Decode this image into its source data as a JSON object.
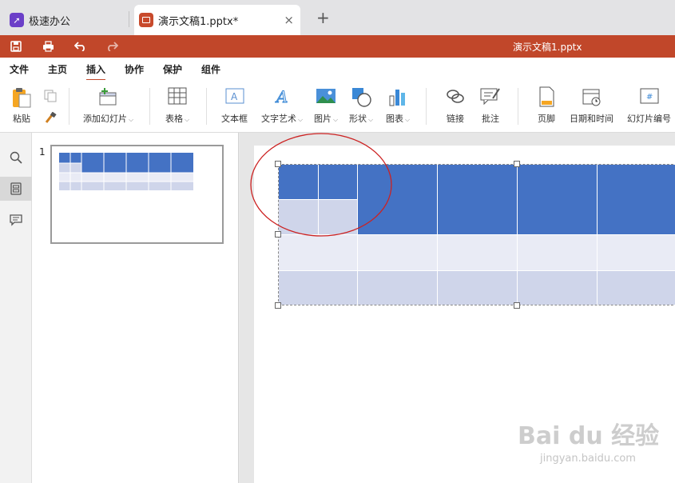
{
  "tabs": {
    "home_label": "极速办公",
    "doc_label": "演示文稿1.pptx*",
    "close_glyph": "×",
    "add_glyph": "+"
  },
  "titlebar": {
    "title": "演示文稿1.pptx"
  },
  "menu": {
    "items": [
      "文件",
      "主页",
      "插入",
      "协作",
      "保护",
      "组件"
    ],
    "active": "插入"
  },
  "ribbon": {
    "paste": "粘贴",
    "add_slide": "添加幻灯片",
    "table": "表格",
    "textbox": "文本框",
    "wordart": "文字艺术",
    "picture": "图片",
    "shape": "形状",
    "chart": "图表",
    "link": "链接",
    "comment": "批注",
    "footer": "页脚",
    "datetime": "日期和时间",
    "slide_number": "幻灯片编号"
  },
  "thumbnails": {
    "number": "1"
  },
  "watermark": {
    "brand": "Bai du 经验",
    "url": "jingyan.baidu.com"
  },
  "colors": {
    "accent": "#c1472a",
    "table_header": "#4472c4",
    "table_band": "#cfd5ea",
    "table_light": "#e9ebf5",
    "annotation": "#cc2222"
  }
}
